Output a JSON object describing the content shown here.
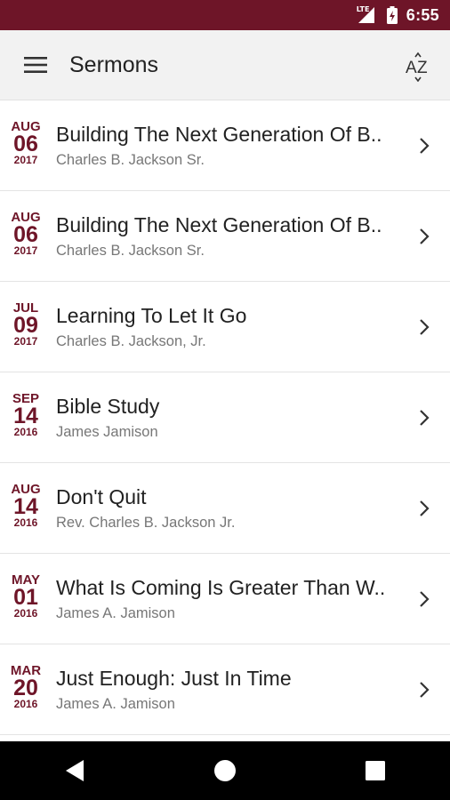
{
  "status_bar": {
    "network": "LTE",
    "time": "6:55",
    "accent": "#6e1528"
  },
  "app_bar": {
    "title": "Sermons",
    "sort_icon": "sort-alpha-icon",
    "menu_icon": "hamburger-menu-icon"
  },
  "sermons": [
    {
      "month": "AUG",
      "day": "06",
      "year": "2017",
      "title": "Building The Next Generation Of B..",
      "speaker": "Charles B. Jackson Sr."
    },
    {
      "month": "AUG",
      "day": "06",
      "year": "2017",
      "title": "Building The Next Generation Of B..",
      "speaker": "Charles B. Jackson Sr."
    },
    {
      "month": "JUL",
      "day": "09",
      "year": "2017",
      "title": "Learning To Let It Go",
      "speaker": "Charles B. Jackson, Jr."
    },
    {
      "month": "SEP",
      "day": "14",
      "year": "2016",
      "title": "Bible Study",
      "speaker": "James Jamison"
    },
    {
      "month": "AUG",
      "day": "14",
      "year": "2016",
      "title": "Don't Quit",
      "speaker": "Rev. Charles B. Jackson Jr."
    },
    {
      "month": "MAY",
      "day": "01",
      "year": "2016",
      "title": "What Is Coming Is Greater Than W..",
      "speaker": "James A. Jamison"
    },
    {
      "month": "MAR",
      "day": "20",
      "year": "2016",
      "title": "Just Enough: Just In Time",
      "speaker": "James A. Jamison"
    }
  ],
  "nav_bar": {
    "back_icon": "back-icon",
    "home_icon": "home-icon",
    "recents_icon": "recents-icon"
  }
}
